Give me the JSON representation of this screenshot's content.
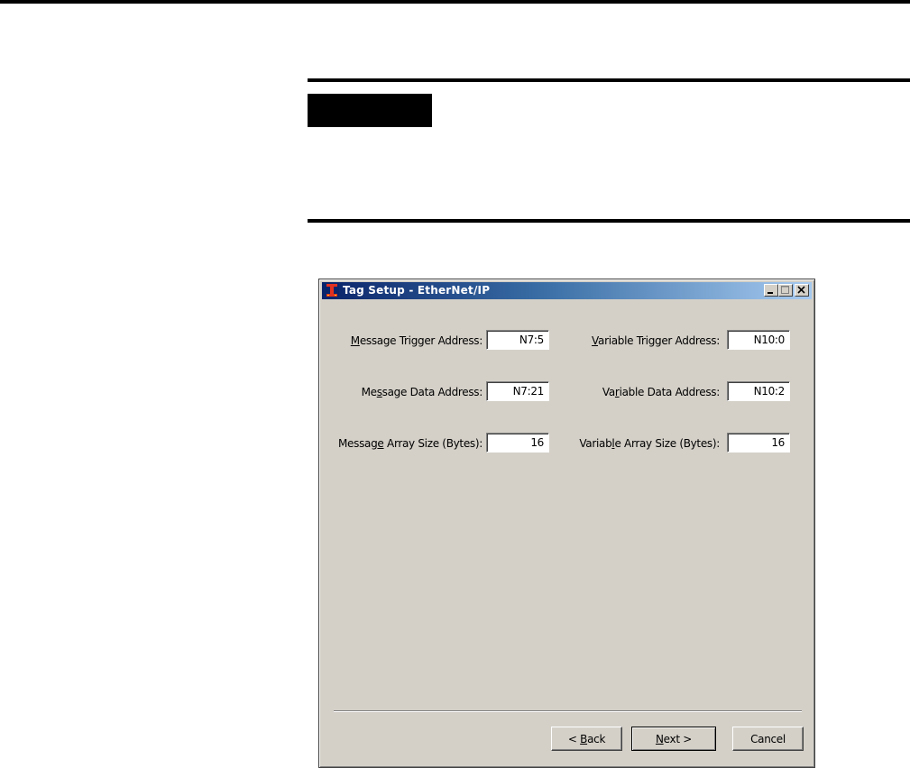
{
  "dialog": {
    "title": "Tag Setup - EtherNet/IP",
    "icon": "app-icon",
    "fields": {
      "message_trigger": {
        "label_pre": "",
        "label_u": "M",
        "label_post": "essage Trigger Address:",
        "value": "N7:5"
      },
      "message_data": {
        "label_pre": "Me",
        "label_u": "s",
        "label_post": "sage Data Address:",
        "value": "N7:21"
      },
      "message_array": {
        "label_pre": "Messag",
        "label_u": "e",
        "label_post": " Array Size (Bytes):",
        "value": "16"
      },
      "variable_trigger": {
        "label_pre": "",
        "label_u": "V",
        "label_post": "ariable Trigger Address:",
        "value": "N10:0"
      },
      "variable_data": {
        "label_pre": "Va",
        "label_u": "r",
        "label_post": "iable Data Address:",
        "value": "N10:2"
      },
      "variable_array": {
        "label_pre": "Variab",
        "label_u": "l",
        "label_post": "e Array Size (Bytes):",
        "value": "16"
      }
    },
    "buttons": {
      "back": {
        "pre": "< ",
        "u": "B",
        "post": "ack"
      },
      "next": {
        "pre": "",
        "u": "N",
        "post": "ext >"
      },
      "cancel": "Cancel"
    }
  }
}
